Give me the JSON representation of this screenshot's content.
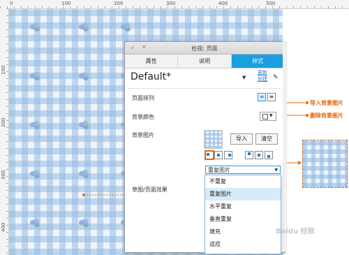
{
  "rulers": {
    "top": [
      "0",
      "100",
      "200",
      "300",
      "400",
      "500"
    ],
    "left": [
      "100",
      "200",
      "300",
      "400"
    ]
  },
  "panel": {
    "title": "检视: 页面",
    "tabs": [
      {
        "label": "属性",
        "active": false
      },
      {
        "label": "说明",
        "active": false
      },
      {
        "label": "样式",
        "active": true
      }
    ],
    "page_name": "Default*",
    "links": [
      "更新",
      "创建"
    ],
    "rows": {
      "page_align": "页面排列",
      "bg_color": "背景颜色",
      "bg_image": "背景图片",
      "sketch": "草图/页面效果"
    },
    "import_button": "导入",
    "clear_button": "清空",
    "repeat_select": "重复图片",
    "repeat_options": [
      "不重复",
      "重复图片",
      "水平重复",
      "垂直重复",
      "填充",
      "适应"
    ],
    "highlighted_option": "重复图片"
  },
  "annotations": {
    "import": "导入背景图片",
    "delete": "删除背景图片"
  },
  "colors": {
    "accent": "#1a9fe0",
    "annotation": "#e06a10"
  },
  "watermark": "Baidu 经验"
}
